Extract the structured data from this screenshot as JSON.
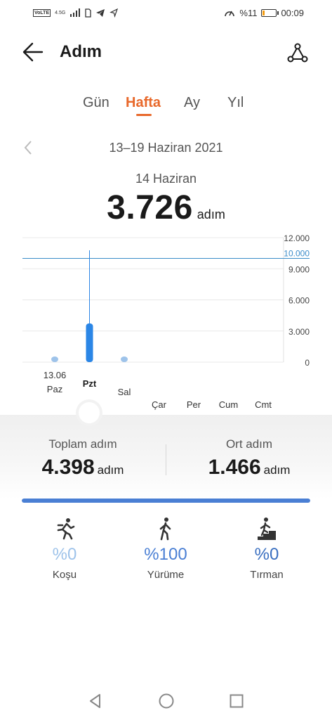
{
  "status_bar": {
    "volte": "VoLTE",
    "network": "4.5G",
    "battery_text": "%11",
    "battery_level": 0.11,
    "time": "00:09"
  },
  "app_bar": {
    "title": "Adım",
    "back_icon": "arrow-left-icon",
    "share_icon": "route-share-icon"
  },
  "tabs": [
    {
      "label": "Gün",
      "active": false
    },
    {
      "label": "Hafta",
      "active": true
    },
    {
      "label": "Ay",
      "active": false
    },
    {
      "label": "Yıl",
      "active": false
    }
  ],
  "date_range": "13–19 Haziran 2021",
  "selected": {
    "date": "14 Haziran",
    "value": "3.726",
    "unit": "adım"
  },
  "chart_data": {
    "type": "bar",
    "categories": [
      "Paz",
      "Pzt",
      "Sal",
      "Çar",
      "Per",
      "Cum",
      "Cmt"
    ],
    "values": [
      398,
      3726,
      274,
      0,
      0,
      0,
      0
    ],
    "selected_index": 1,
    "selected_date_label": "13.06",
    "ylim": [
      0,
      12000
    ],
    "y_ticks": [
      "0",
      "3.000",
      "6.000",
      "9.000",
      "12.000"
    ],
    "y_tick_values": [
      0,
      3000,
      6000,
      9000,
      12000
    ],
    "goal_value": 10000,
    "goal_label": "10.000",
    "grid": true,
    "accent": "#2b86e6",
    "goal_color": "#3a8cc9"
  },
  "summary": {
    "total_label": "Toplam adım",
    "total_value": "4.398",
    "total_unit": "adım",
    "avg_label": "Ort adım",
    "avg_value": "1.466",
    "avg_unit": "adım"
  },
  "activity_progress": 1.0,
  "activities": [
    {
      "icon": "running-icon",
      "percent": "%0",
      "label": "Koşu",
      "color": "#9ec3ea"
    },
    {
      "icon": "walking-icon",
      "percent": "%100",
      "label": "Yürüme",
      "color": "#4a7fd4"
    },
    {
      "icon": "stairs-climbing-icon",
      "percent": "%0",
      "label": "Tırman",
      "color": "#3a6fc0"
    }
  ],
  "nav": {
    "back_icon": "nav-back-icon",
    "home_icon": "nav-home-icon",
    "recents_icon": "nav-recents-icon"
  }
}
